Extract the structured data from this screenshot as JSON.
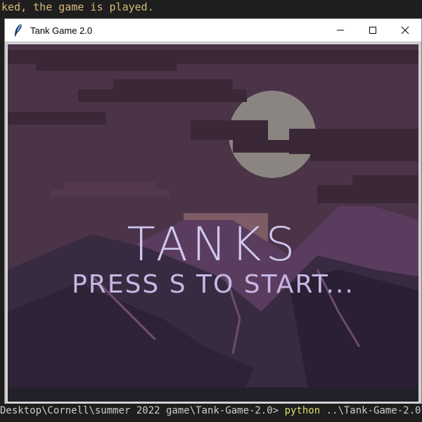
{
  "terminal": {
    "top_line": "ked, the game is played.",
    "prompt_path": "Desktop\\Cornell\\summer 2022 game\\Tank-Game-2.0> ",
    "prompt_cmd": "python",
    "prompt_args": " ..\\Tank-Game-2.0\\"
  },
  "window": {
    "title": "Tank Game 2.0",
    "icons": {
      "app": "feather-icon",
      "minimize": "minimize-icon",
      "maximize": "maximize-icon",
      "close": "close-icon"
    }
  },
  "game": {
    "title": "TANKS",
    "prompt": "PRESS S TO START..."
  }
}
